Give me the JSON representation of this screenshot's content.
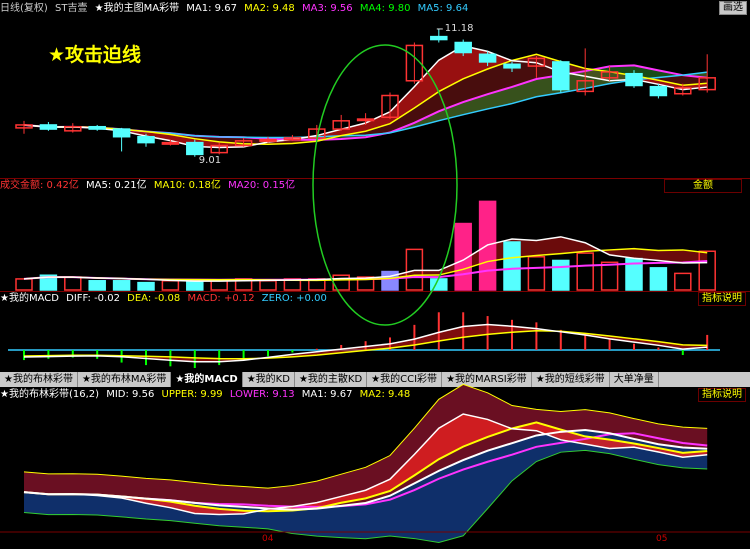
{
  "header": {
    "mode": "日线(复权)",
    "stock": "ST吉壹",
    "indicator": "★我的主图MA彩带",
    "ma": [
      {
        "label": "MA1: 9.67",
        "color": "#ffffff"
      },
      {
        "label": "MA2: 9.48",
        "color": "#ffff00"
      },
      {
        "label": "MA3: 9.56",
        "color": "#ff33ff"
      },
      {
        "label": "MA4: 9.80",
        "color": "#00ff00"
      },
      {
        "label": "MA5: 9.64",
        "color": "#33ccff"
      }
    ],
    "right_button": "画选"
  },
  "title_overlay": "★攻击迫线",
  "price_labels": {
    "high": "11.18",
    "low": "9.01"
  },
  "volume_header": {
    "label": "成交金额: 0.42亿",
    "ma": [
      {
        "label": "MA5: 0.21亿",
        "color": "#ffffff"
      },
      {
        "label": "MA10: 0.18亿",
        "color": "#ffff00"
      },
      {
        "label": "MA20: 0.15亿",
        "color": "#ff33ff"
      }
    ],
    "right_button": "金额"
  },
  "macd_header": {
    "name": "★我的MACD",
    "items": [
      {
        "label": "DIFF: -0.02",
        "color": "#ffffff"
      },
      {
        "label": "DEA: -0.08",
        "color": "#ffff00"
      },
      {
        "label": "MACD: +0.12",
        "color": "#ff3333"
      },
      {
        "label": "ZERO: +0.00",
        "color": "#33ccff"
      }
    ],
    "right_button": "指标说明"
  },
  "toolbar": {
    "tabs": [
      {
        "label": "★我的布林彩带",
        "active": false
      },
      {
        "label": "★我的布林MA彩带",
        "active": false
      },
      {
        "label": "★我的MACD",
        "active": true
      },
      {
        "label": "★我的KD",
        "active": false
      },
      {
        "label": "★我的主散KD",
        "active": false
      },
      {
        "label": "★我的CCI彩带",
        "active": false
      },
      {
        "label": "★我的MARSI彩带",
        "active": false
      },
      {
        "label": "★我的短线彩带",
        "active": false
      },
      {
        "label": "大单净量",
        "active": false
      }
    ]
  },
  "boll_header": {
    "name": "★我的布林彩带(16,2)",
    "items": [
      {
        "label": "MID: 9.56",
        "color": "#ffffff"
      },
      {
        "label": "UPPER: 9.99",
        "color": "#ffff00"
      },
      {
        "label": "LOWER: 9.13",
        "color": "#ff33ff"
      },
      {
        "label": "MA1: 9.67",
        "color": "#ffffff"
      },
      {
        "label": "MA2: 9.48",
        "color": "#ffff00"
      }
    ],
    "right_button": "指标说明"
  },
  "x_axis": {
    "ticks": [
      "04",
      "05"
    ]
  },
  "colors": {
    "up": "#ff3333",
    "down": "#55ffff",
    "ellipse": "#22cc22"
  },
  "chart_data": {
    "type": "candlestick",
    "title": "",
    "candles": [
      {
        "o": 9.5,
        "c": 9.55,
        "h": 9.62,
        "l": 9.4
      },
      {
        "o": 9.55,
        "c": 9.48,
        "h": 9.6,
        "l": 9.45
      },
      {
        "o": 9.45,
        "c": 9.52,
        "h": 9.58,
        "l": 9.42
      },
      {
        "o": 9.52,
        "c": 9.48,
        "h": 9.55,
        "l": 9.45
      },
      {
        "o": 9.48,
        "c": 9.35,
        "h": 9.5,
        "l": 9.1
      },
      {
        "o": 9.35,
        "c": 9.25,
        "h": 9.4,
        "l": 9.18
      },
      {
        "o": 9.25,
        "c": 9.25,
        "h": 9.3,
        "l": 9.2
      },
      {
        "o": 9.25,
        "c": 9.05,
        "h": 9.3,
        "l": 9.01
      },
      {
        "o": 9.08,
        "c": 9.2,
        "h": 9.25,
        "l": 9.05
      },
      {
        "o": 9.2,
        "c": 9.28,
        "h": 9.33,
        "l": 9.18
      },
      {
        "o": 9.28,
        "c": 9.3,
        "h": 9.35,
        "l": 9.25
      },
      {
        "o": 9.3,
        "c": 9.33,
        "h": 9.38,
        "l": 9.28
      },
      {
        "o": 9.33,
        "c": 9.48,
        "h": 9.55,
        "l": 9.3
      },
      {
        "o": 9.48,
        "c": 9.62,
        "h": 9.72,
        "l": 9.45
      },
      {
        "o": 9.65,
        "c": 9.65,
        "h": 9.75,
        "l": 9.55
      },
      {
        "o": 9.68,
        "c": 10.05,
        "h": 10.1,
        "l": 9.65
      },
      {
        "o": 10.3,
        "c": 10.9,
        "h": 10.95,
        "l": 10.25
      },
      {
        "o": 11.05,
        "c": 11.0,
        "h": 11.18,
        "l": 10.95
      },
      {
        "o": 10.95,
        "c": 10.78,
        "h": 11.0,
        "l": 10.72
      },
      {
        "o": 10.75,
        "c": 10.62,
        "h": 10.8,
        "l": 10.55
      },
      {
        "o": 10.58,
        "c": 10.52,
        "h": 10.62,
        "l": 10.45
      },
      {
        "o": 10.55,
        "c": 10.68,
        "h": 10.72,
        "l": 10.35
      },
      {
        "o": 10.62,
        "c": 10.15,
        "h": 10.65,
        "l": 10.1
      },
      {
        "o": 10.12,
        "c": 10.3,
        "h": 10.85,
        "l": 10.05
      },
      {
        "o": 10.35,
        "c": 10.45,
        "h": 10.55,
        "l": 10.3
      },
      {
        "o": 10.42,
        "c": 10.22,
        "h": 10.48,
        "l": 10.18
      },
      {
        "o": 10.2,
        "c": 10.05,
        "h": 10.25,
        "l": 10.0
      },
      {
        "o": 10.08,
        "c": 10.18,
        "h": 10.25,
        "l": 10.05
      },
      {
        "o": 10.15,
        "c": 10.35,
        "h": 10.75,
        "l": 10.1
      }
    ],
    "ylim": [
      8.7,
      11.4
    ],
    "volume": [
      0.06,
      0.08,
      0.07,
      0.05,
      0.05,
      0.04,
      0.05,
      0.05,
      0.05,
      0.06,
      0.05,
      0.06,
      0.06,
      0.08,
      0.07,
      0.1,
      0.22,
      0.06,
      0.36,
      0.48,
      0.26,
      0.18,
      0.16,
      0.2,
      0.15,
      0.17,
      0.12,
      0.09,
      0.21
    ],
    "macd": [
      -0.08,
      -0.07,
      -0.06,
      -0.07,
      -0.1,
      -0.12,
      -0.13,
      -0.15,
      -0.12,
      -0.08,
      -0.05,
      -0.02,
      0.01,
      0.04,
      0.07,
      0.1,
      0.2,
      0.3,
      0.3,
      0.27,
      0.24,
      0.22,
      0.16,
      0.13,
      0.09,
      0.05,
      0.02,
      -0.04,
      0.12
    ]
  }
}
